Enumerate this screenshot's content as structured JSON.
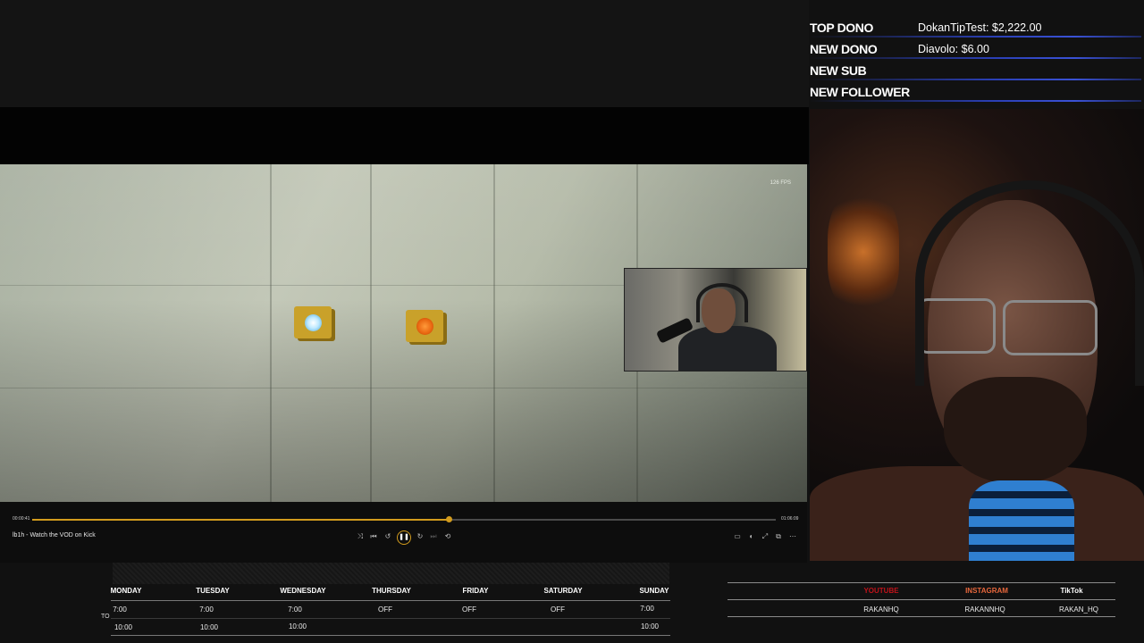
{
  "overlay": {
    "rows": [
      {
        "label": "TOP DONO",
        "value": "DokanTipTest: $2,222.00"
      },
      {
        "label": "NEW DONO",
        "value": "Diavolo: $6.00"
      },
      {
        "label": "NEW SUB",
        "value": ""
      },
      {
        "label": "NEW FOLLOWER",
        "value": ""
      }
    ]
  },
  "player": {
    "fps_readout": "126 FPS",
    "time_current": "00:00:41",
    "time_total": "01:06:09",
    "progress_fraction": 0.56,
    "title": "lb1h - Watch the VOD on Kick",
    "accent_color": "#d29b1d",
    "controls": {
      "shuffle": "shuffle-icon",
      "previous": "skip-back-icon",
      "rewind": "rewind-10-icon",
      "play_pause": "pause-icon",
      "forward": "forward-10-icon",
      "next": "skip-forward-icon",
      "repeat": "repeat-icon",
      "right": [
        "subtitles-icon",
        "volume-icon",
        "fullscreen-icon",
        "popout-icon",
        "more-icon"
      ]
    }
  },
  "schedule": {
    "days": [
      "MONDAY",
      "TUESDAY",
      "WEDNESDAY",
      "THURSDAY",
      "FRIDAY",
      "SATURDAY",
      "SUNDAY"
    ],
    "start_times": [
      "7:00",
      "7:00",
      "7:00",
      "OFF",
      "OFF",
      "OFF",
      "7:00"
    ],
    "end_times": [
      "10:00",
      "10:00",
      "10:00",
      "",
      "",
      "",
      "10:00"
    ],
    "to_label": "TO"
  },
  "socials": {
    "headers": [
      {
        "name": "YOUTUBE",
        "color": "#c0121a"
      },
      {
        "name": "INSTAGRAM",
        "color": "#e8673c"
      },
      {
        "name": "TikTok",
        "color": "#ffffff"
      }
    ],
    "handles": [
      "RAKANHQ",
      "RAKANNHQ",
      "RAKAN_HQ"
    ]
  }
}
